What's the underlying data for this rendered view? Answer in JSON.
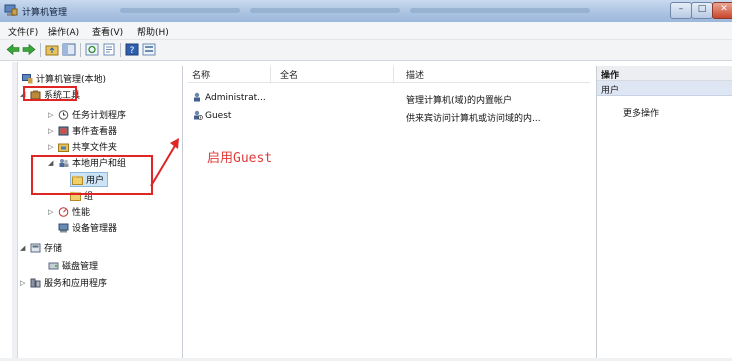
{
  "window": {
    "title": "计算机管理"
  },
  "menu": [
    "文件(F)",
    "操作(A)",
    "查看(V)",
    "帮助(H)"
  ],
  "tree": {
    "root": "计算机管理(本地)",
    "system_tools": "系统工具",
    "task_scheduler": "任务计划程序",
    "event_viewer": "事件查看器",
    "shared_folders": "共享文件夹",
    "local_users_groups": "本地用户和组",
    "users": "用户",
    "groups": "组",
    "performance": "性能",
    "device_manager": "设备管理器",
    "storage": "存储",
    "disk_management": "磁盘管理",
    "services_apps": "服务和应用程序"
  },
  "list": {
    "headers": {
      "name": "名称",
      "fullname": "全名",
      "description": "描述"
    },
    "rows": [
      {
        "name": "Administrat...",
        "fullname": "",
        "description": "管理计算机(域)的内置帐户"
      },
      {
        "name": "Guest",
        "fullname": "",
        "description": "供来宾访问计算机或访问域的内..."
      }
    ]
  },
  "actions": {
    "header": "操作",
    "section": "用户",
    "more": "更多操作"
  },
  "annotation": {
    "text": "启用Guest"
  },
  "colors": {
    "annotation": "#e02525",
    "selection": "#cde4f7"
  }
}
